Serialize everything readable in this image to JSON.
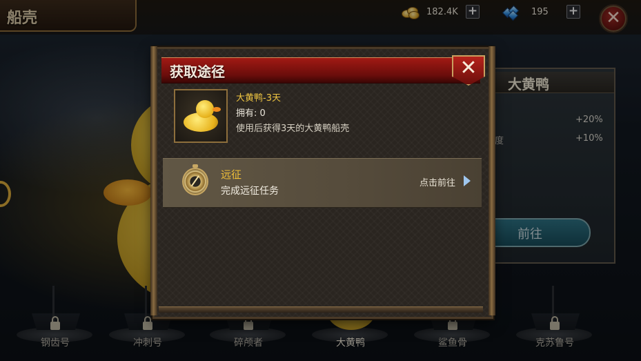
{
  "header": {
    "title": "船壳",
    "gold_amount": "182.4K",
    "gem_amount": "195",
    "gold_icon": "coin-stack-icon",
    "gem_icon": "gem-icon",
    "close_icon": "close-icon"
  },
  "info_panel": {
    "title": "大黄鸭",
    "stat_1_label": "",
    "stat_1_value": "+20%",
    "stat_2_label": "速度",
    "stat_2_value": "+10%",
    "goto_label": "前往"
  },
  "ships": [
    {
      "name": "钢齿号",
      "locked": true
    },
    {
      "name": "冲刺号",
      "locked": true
    },
    {
      "name": "碎颅者",
      "locked": true
    },
    {
      "name": "大黄鸭",
      "locked": false
    },
    {
      "name": "鲨鱼骨",
      "locked": true
    },
    {
      "name": "克苏鲁号",
      "locked": true
    }
  ],
  "modal": {
    "title": "获取途径",
    "close_icon": "close-icon",
    "item": {
      "name": "大黄鸭-3天",
      "owned": "拥有: 0",
      "description": "使用后获得3天的大黄鸭船壳",
      "icon": "rubber-duck-icon"
    },
    "source": {
      "title": "远征",
      "description": "完成远征任务",
      "goto_label": "点击前往",
      "icon": "compass-icon"
    }
  },
  "colors": {
    "header_red": "#a11a14",
    "item_name_gold": "#f0c642",
    "source_title_gold": "#f0bf38",
    "arrow_blue": "#9fc6ee"
  }
}
